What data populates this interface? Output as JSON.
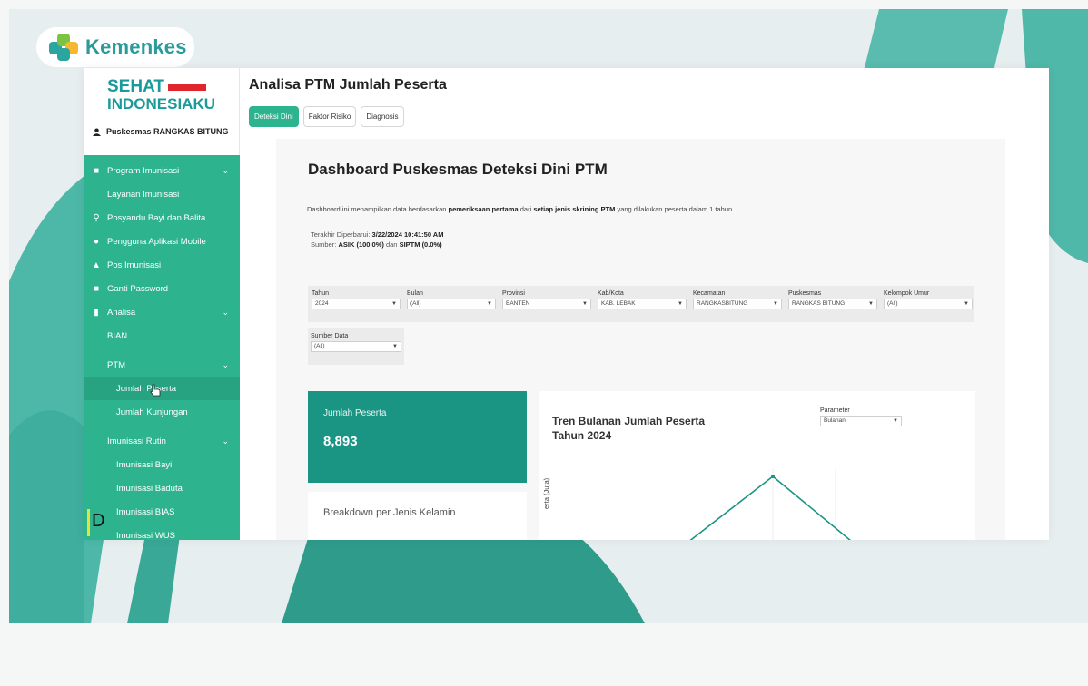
{
  "brand": {
    "logo_text": "Kemenkes",
    "colors": {
      "teal": "#2db48f",
      "dark_teal": "#1a9483",
      "red": "#e0262c"
    }
  },
  "sidebar": {
    "brand_line1": "SEHAT",
    "brand_line2": "INDONESIAKU",
    "user": "Puskesmas RANGKAS BITUNG",
    "items": [
      {
        "label": "Program Imunisasi",
        "icon": "briefcase-icon"
      },
      {
        "label": "Layanan Imunisasi"
      },
      {
        "label": "Posyandu Bayi dan Balita",
        "icon": "baby-icon"
      },
      {
        "label": "Pengguna Aplikasi Mobile",
        "icon": "users-icon"
      },
      {
        "label": "Pos Imunisasi",
        "icon": "home-icon"
      },
      {
        "label": "Ganti Password",
        "icon": "lock-icon"
      },
      {
        "label": "Analisa",
        "icon": "bar-chart-icon"
      },
      {
        "label": "BIAN"
      },
      {
        "label": "PTM"
      },
      {
        "label": "Jumlah Peserta"
      },
      {
        "label": "Jumlah Kunjungan"
      },
      {
        "label": "Imunisasi Rutin"
      },
      {
        "label": "Imunisasi Bayi"
      },
      {
        "label": "Imunisasi Baduta"
      },
      {
        "label": "Imunisasi BIAS"
      },
      {
        "label": "Imunisasi WUS"
      }
    ]
  },
  "page": {
    "title": "Analisa PTM Jumlah Peserta",
    "tabs": [
      "Deteksi Dini",
      "Faktor Risiko",
      "Diagnosis"
    ]
  },
  "dashboard": {
    "title": "Dashboard Puskesmas Deteksi Dini PTM",
    "desc_pre": "Dashboard ini menampilkan data berdasarkan ",
    "desc_b1": "pemeriksaan pertama",
    "desc_mid": " dari ",
    "desc_b2": "setiap jenis skrining PTM",
    "desc_post": " yang dilakukan peserta dalam 1 tahun",
    "updated_label": "Terakhir Diperbarui: ",
    "updated_value": "3/22/2024 10:41:50 AM",
    "source_label": "Sumber: ",
    "source_asik": "ASIK (100.0%)",
    "source_and": " dan ",
    "source_siptm": "SIPTM (0.0%)",
    "filters": [
      {
        "label": "Tahun",
        "value": "2024"
      },
      {
        "label": "Bulan",
        "value": "(All)"
      },
      {
        "label": "Provinsi",
        "value": "BANTEN"
      },
      {
        "label": "Kab/Kota",
        "value": "KAB. LEBAK"
      },
      {
        "label": "Kecamatan",
        "value": "RANGKASBITUNG"
      },
      {
        "label": "Puskesmas",
        "value": "RANGKAS BITUNG"
      },
      {
        "label": "Kelompok Umur",
        "value": "(All)"
      }
    ],
    "filter_sumber": {
      "label": "Sumber Data",
      "value": "(All)"
    },
    "kpi": {
      "label": "Jumlah Peserta",
      "value": "8,893"
    },
    "breakdown_label": "Breakdown per Jenis Kelamin",
    "trend": {
      "title_line1": "Tren Bulanan Jumlah Peserta",
      "title_line2": "Tahun 2024",
      "param_label": "Parameter",
      "param_value": "Bulanan",
      "ylabel_fragment": "erta (Juta)"
    }
  }
}
